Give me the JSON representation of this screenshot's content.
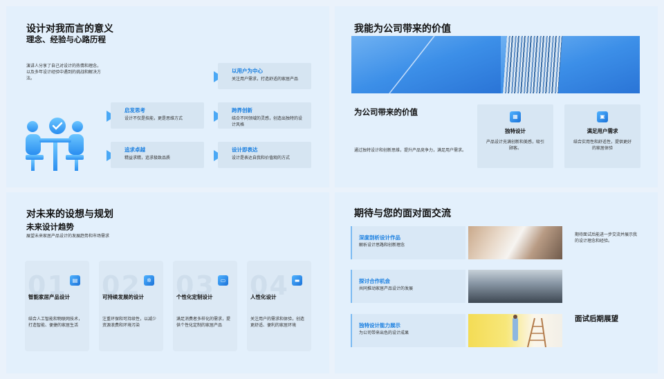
{
  "slide1": {
    "title": "设计对我而言的意义",
    "subtitle": "理念、经验与心路历程",
    "intro": "演讲人分享了自己对设计的热情和理念，以及多年设计经验中遇到的挑战和解决方法。",
    "cards": [
      {
        "title": "以用户为中心",
        "desc": "关注用户需求，打造舒适的家居产品"
      },
      {
        "title": "启发思考",
        "desc": "设计不仅是技能，更是思维方式"
      },
      {
        "title": "跨界创新",
        "desc": "结合不同领域的灵感，创造出独特的设计风格"
      },
      {
        "title": "追求卓越",
        "desc": "精益求精，追求极致品质"
      },
      {
        "title": "设计即表达",
        "desc": "设计是表达自我和价值观的方式"
      }
    ]
  },
  "slide2": {
    "title": "我能为公司带来的价值",
    "section_title": "为公司带来的价值",
    "section_desc": "通过独特设计和创新思维，提升产品竞争力，满足用户需求。",
    "cards": [
      {
        "title": "独特设计",
        "desc": "产品设计充满创新和美感，吸引顾客。"
      },
      {
        "title": "满足用户需求",
        "desc": "结合实用性和舒适性，提供更好的家居体验"
      }
    ]
  },
  "slide3": {
    "title": "对未来的设想与规划",
    "subtitle": "未来设计趋势",
    "desc": "展望未来家居产品设计的发展趋势和市场需求",
    "trends": [
      {
        "num": "01",
        "title": "智能家居产品设计",
        "desc": "结合人工智能和物联网技术，打造智能、便捷的家居生活"
      },
      {
        "num": "02",
        "title": "可持续发展的设计",
        "desc": "注重环保和可持续性，以减少资源浪费和环境污染"
      },
      {
        "num": "03",
        "title": "个性化定制设计",
        "desc": "满足消费者多样化的需求，提供个性化定制的家居产品"
      },
      {
        "num": "04",
        "title": "人性化设计",
        "desc": "关注用户的需求和体验，创造更舒适、便利的家居环境"
      }
    ]
  },
  "slide4": {
    "title": "期待与您的面对面交流",
    "items": [
      {
        "title": "深度剖析设计作品",
        "desc": "解析设计思路和创新理念"
      },
      {
        "title": "探讨合作机会",
        "desc": "共同推动家居产品设计的发展"
      },
      {
        "title": "独特设计能力展示",
        "desc": "为公司带来出色的设计成果"
      }
    ],
    "side_text": "期待面试后能进一步交流并展示我的设计理念和经验。",
    "side_title": "面试后期展望"
  },
  "colors": {
    "accent": "#1a7fe0",
    "card": "#d6e5f2",
    "slide_bg": "#e3f0fc"
  }
}
